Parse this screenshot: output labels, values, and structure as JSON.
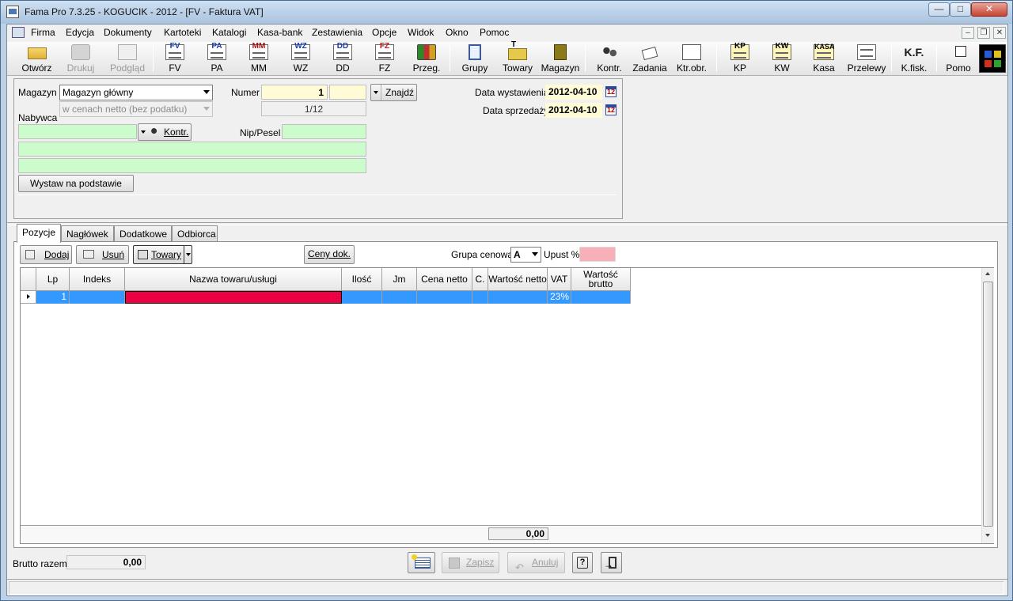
{
  "window": {
    "title": "Fama Pro 7.3.25 - KOGUCIK - 2012 - [FV - Faktura VAT]",
    "min": "—",
    "max": "□",
    "close": "✕"
  },
  "menu": {
    "items": [
      "Firma",
      "Edycja",
      "Dokumenty",
      "Kartoteki",
      "Katalogi",
      "Kasa-bank",
      "Zestawienia",
      "Opcje",
      "Widok",
      "Okno",
      "Pomoc"
    ],
    "mdi_min": "–",
    "mdi_restore": "❐",
    "mdi_close": "✕"
  },
  "toolbar": {
    "buttons": [
      {
        "label": "Otwórz",
        "code": "",
        "icon": "folder-icon",
        "enabled": true
      },
      {
        "label": "Drukuj",
        "code": "",
        "icon": "printer-icon",
        "enabled": false
      },
      {
        "label": "Podgląd",
        "code": "",
        "icon": "preview-icon",
        "enabled": false
      },
      {
        "label": "FV",
        "code": "FV",
        "icon": "invoice-icon",
        "enabled": true
      },
      {
        "label": "PA",
        "code": "PA",
        "icon": "receipt-icon",
        "enabled": true
      },
      {
        "label": "MM",
        "code": "MM",
        "icon": "transfer-icon",
        "enabled": true
      },
      {
        "label": "WZ",
        "code": "WZ",
        "icon": "dispatch-icon",
        "enabled": true
      },
      {
        "label": "DD",
        "code": "DD",
        "icon": "delivery-icon",
        "enabled": true
      },
      {
        "label": "FZ",
        "code": "FZ",
        "icon": "purchase-invoice-icon",
        "enabled": true
      },
      {
        "label": "Przeg.",
        "code": "",
        "icon": "binders-icon",
        "enabled": true
      },
      {
        "label": "Grupy",
        "code": "",
        "icon": "groups-icon",
        "enabled": true
      },
      {
        "label": "Towary",
        "code": "T",
        "icon": "goods-icon",
        "enabled": true
      },
      {
        "label": "Magazyn",
        "code": "",
        "icon": "warehouse-door-icon",
        "enabled": true
      },
      {
        "label": "Kontr.",
        "code": "",
        "icon": "contractors-icon",
        "enabled": true
      },
      {
        "label": "Zadania",
        "code": "",
        "icon": "tasks-icon",
        "enabled": true
      },
      {
        "label": "Ktr.obr.",
        "code": "",
        "icon": "turnover-icon",
        "enabled": true
      },
      {
        "label": "KP",
        "code": "KP",
        "icon": "cash-in-icon",
        "enabled": true
      },
      {
        "label": "KW",
        "code": "KW",
        "icon": "cash-out-icon",
        "enabled": true
      },
      {
        "label": "Kasa",
        "code": "KASA",
        "icon": "cash-register-icon",
        "enabled": true
      },
      {
        "label": "Przelewy",
        "code": "",
        "icon": "transfer-form-icon",
        "enabled": true
      },
      {
        "label": "K.fisk.",
        "code": "K.F.",
        "icon": "fiscal-icon",
        "enabled": true
      },
      {
        "label": "Pomo",
        "code": "",
        "icon": "help-cursor-icon",
        "enabled": true
      }
    ]
  },
  "header": {
    "magazyn_label": "Magazyn",
    "magazyn_value": "Magazyn główny",
    "prices_value": "w cenach netto (bez podatku)",
    "nabywca_label": "Nabywca",
    "kontr_button": "Kontr.",
    "numer_label": "Numer",
    "numer_value": "1",
    "numer_suffix": "",
    "numer_counter": "1/12",
    "znajdz_button": "Znajdź",
    "nip_label": "Nip/Pesel",
    "nip_value": "",
    "buyer_line1": "",
    "buyer_line2": "",
    "data_wyst_label": "Data wystawienia",
    "data_wyst_value": "2012-04-10",
    "data_sprz_label": "Data sprzedaży",
    "data_sprz_value": "2012-04-10",
    "calendar_glyph": "12",
    "wystaw_button": "Wystaw na podstawie"
  },
  "tabs": [
    "Pozycje",
    "Nagłówek",
    "Dodatkowe",
    "Odbiorca"
  ],
  "positions_toolbar": {
    "dodaj": "Dodaj",
    "usun": "Usuń",
    "towary": "Towary",
    "ceny_dok": "Ceny dok.",
    "grupa_label": "Grupa cenowa",
    "grupa_value": "A",
    "upust_label": "Upust %",
    "upust_value": ""
  },
  "grid": {
    "columns": [
      "Lp",
      "Indeks",
      "Nazwa towaru/usługi",
      "Ilość",
      "Jm",
      "Cena netto",
      "C.",
      "Wartość netto",
      "VAT",
      "Wartość brutto"
    ],
    "rows": [
      {
        "lp": "1",
        "indeks": "",
        "nazwa": "",
        "ilosc": "",
        "jm": "",
        "cena": "",
        "c": "",
        "netto": "",
        "vat": "23%",
        "brutto": ""
      }
    ],
    "total": "0,00"
  },
  "bottom": {
    "brutto_label": "Brutto razem",
    "brutto_value": "0,00",
    "zapisz": "Zapisz",
    "anuluj": "Anuluj"
  },
  "colors": {
    "required_field": "#ee0044",
    "selection": "#3399ff",
    "input_yellow": "#fffbd7",
    "input_green": "#ccfbcc",
    "discount_pink": "#f8b0b8"
  }
}
